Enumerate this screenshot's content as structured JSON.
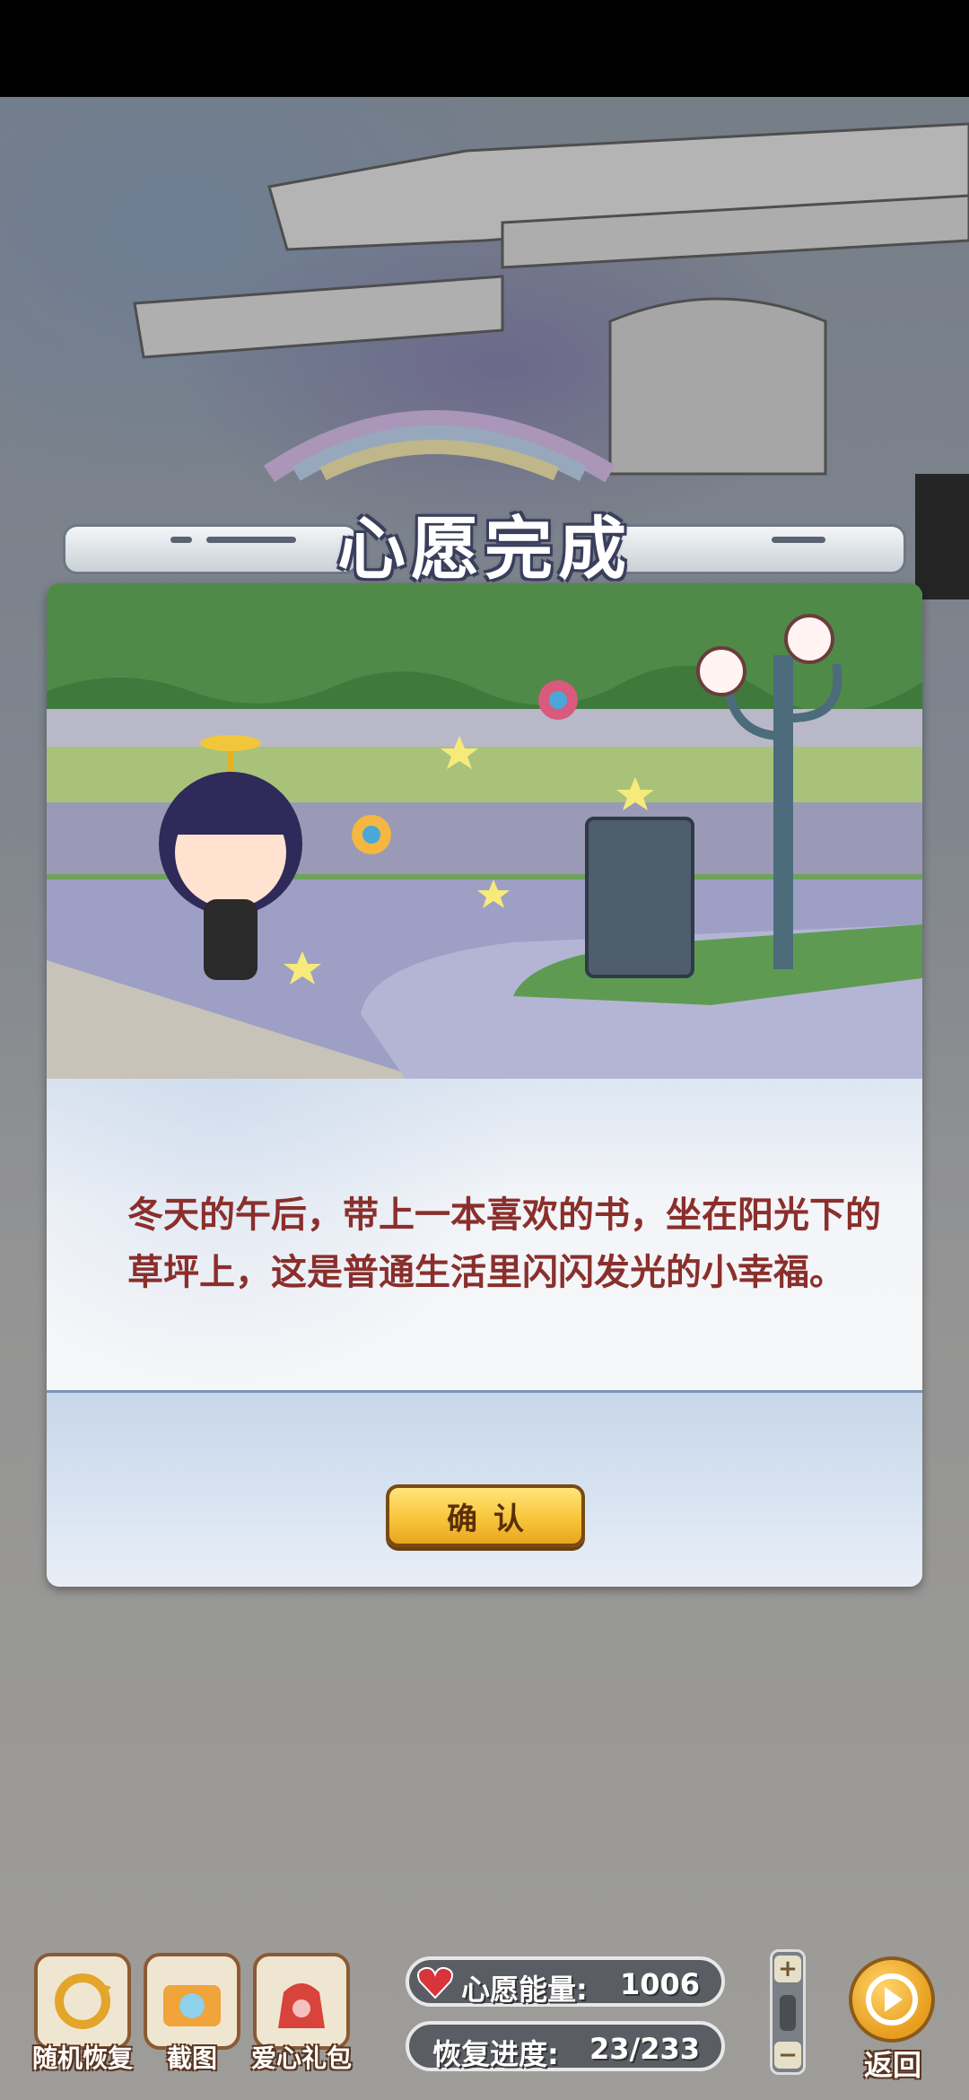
{
  "dialog": {
    "title": "心愿完成",
    "story_text": "冬天的午后，带上一本喜欢的书，坐在阳光下的草坪上，这是普通生活里闪闪发光的小幸福。",
    "confirm_label": "确认"
  },
  "toolbar": {
    "random_restore_label": "随机恢复",
    "screenshot_label": "截图",
    "gift_label": "爱心礼包",
    "wish_energy_label": "心愿能量:",
    "wish_energy_value": "1006",
    "restore_progress_label": "恢复进度:",
    "restore_progress_value": "23/233",
    "back_label": "返回",
    "zoom_in_symbol": "+",
    "zoom_out_symbol": "−"
  },
  "colors": {
    "accent_button": "#f8c53b",
    "story_text": "#8a2f2c",
    "title_outline": "#3a3f5c"
  },
  "icons": [
    "heart-icon",
    "camera-icon",
    "gift-bag-icon",
    "refresh-icon",
    "arrow-right-icon",
    "pinwheel-icon",
    "star-icon"
  ]
}
